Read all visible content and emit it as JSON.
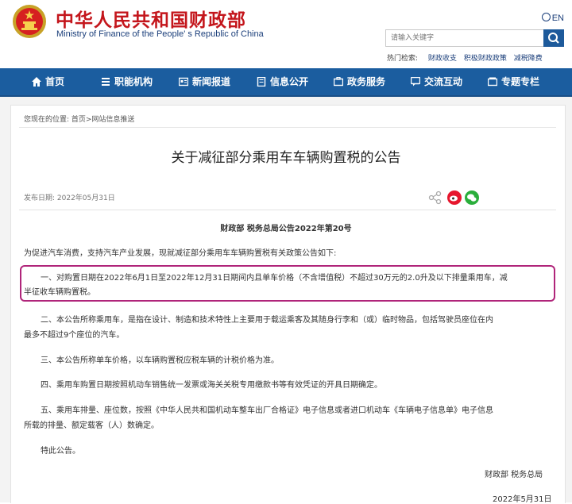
{
  "header": {
    "cn_name": "中华人民共和国财政部",
    "en_name": "Ministry of Finance of the People' s Republic of China",
    "lang": "EN",
    "search_placeholder": "请输入关键字",
    "hot_label": "热门检索:",
    "hot_keywords": [
      "财政收支",
      "积极财政政策",
      "减税降费"
    ]
  },
  "nav": {
    "items": [
      {
        "label": "首页",
        "icon": "home-icon"
      },
      {
        "label": "职能机构",
        "icon": "org-icon"
      },
      {
        "label": "新闻报道",
        "icon": "news-icon"
      },
      {
        "label": "信息公开",
        "icon": "info-icon"
      },
      {
        "label": "政务服务",
        "icon": "service-icon"
      },
      {
        "label": "交流互动",
        "icon": "chat-icon"
      },
      {
        "label": "专题专栏",
        "icon": "column-icon"
      }
    ]
  },
  "breadcrumb": "您现在的位置: 首页>网站信息推送",
  "article": {
    "title": "关于减征部分乘用车车辆购置税的公告",
    "publish_date": "发布日期: 2022年05月31日",
    "subhead": "财政部  税务总局公告2022年第20号",
    "intro": "为促进汽车消费，支持汽车产业发展，现就减征部分乘用车车辆购置税有关政策公告如下:",
    "p1_line1": "一、对购置日期在2022年6月1日至2022年12月31日期间内且单车价格（不含增值税）不超过30万元的2.0升及以下排量乘用车，减",
    "p1_line2": "半征收车辆购置税。",
    "p2_line1": "二、本公告所称乘用车，是指在设计、制造和技术特性上主要用于载运乘客及其随身行李和（或）临时物品，包括驾驶员座位在内",
    "p2_line2": "最多不超过9个座位的汽车。",
    "p3": "三、本公告所称单车价格，以车辆购置税应税车辆的计税价格为准。",
    "p4": "四、乘用车购置日期按照机动车销售统一发票或海关关税专用缴款书等有效凭证的开具日期确定。",
    "p5_line1": "五、乘用车排量、座位数，按照《中华人民共和国机动车整车出厂合格证》电子信息或者进口机动车《车辆电子信息单》电子信息",
    "p5_line2": "所载的排量、额定载客（人）数确定。",
    "p6": "特此公告。",
    "sign": "财政部  税务总局",
    "sign_date": "2022年5月31日"
  },
  "colors": {
    "nav_blue": "#1b5d9f",
    "brand_red": "#c4161c",
    "highlight": "#b0257a"
  }
}
